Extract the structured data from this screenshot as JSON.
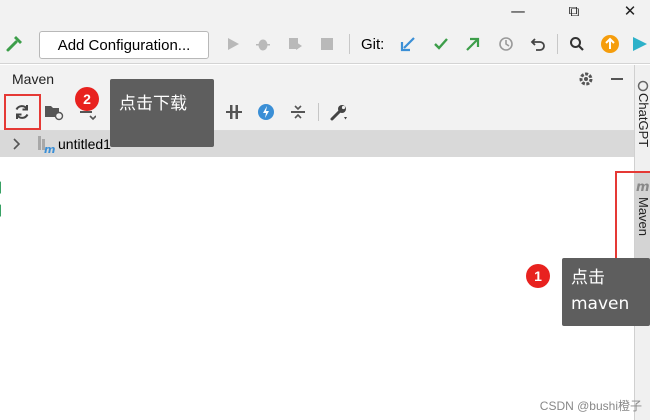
{
  "window": {
    "minimize": "—",
    "restore": "⧉",
    "close": "✕"
  },
  "toolbar": {
    "add_configuration": "Add Configuration...",
    "git_label": "Git:"
  },
  "maven_panel": {
    "title": "Maven",
    "project": "untitled1"
  },
  "right_strip": {
    "chatgpt_label": "ChatGPT",
    "maven_label": "Maven"
  },
  "annotations": {
    "badge_1": "1",
    "badge_2": "2",
    "tooltip_download": "点击下载",
    "tooltip_maven_line1": "点击",
    "tooltip_maven_line2": "maven"
  },
  "watermark": "CSDN @bushi橙子",
  "colors": {
    "accent_blue": "#3b8fd6",
    "git_green": "#3d9e4a",
    "annotation_red": "#e8221f",
    "tooltip_bg": "#5e5e5e"
  }
}
